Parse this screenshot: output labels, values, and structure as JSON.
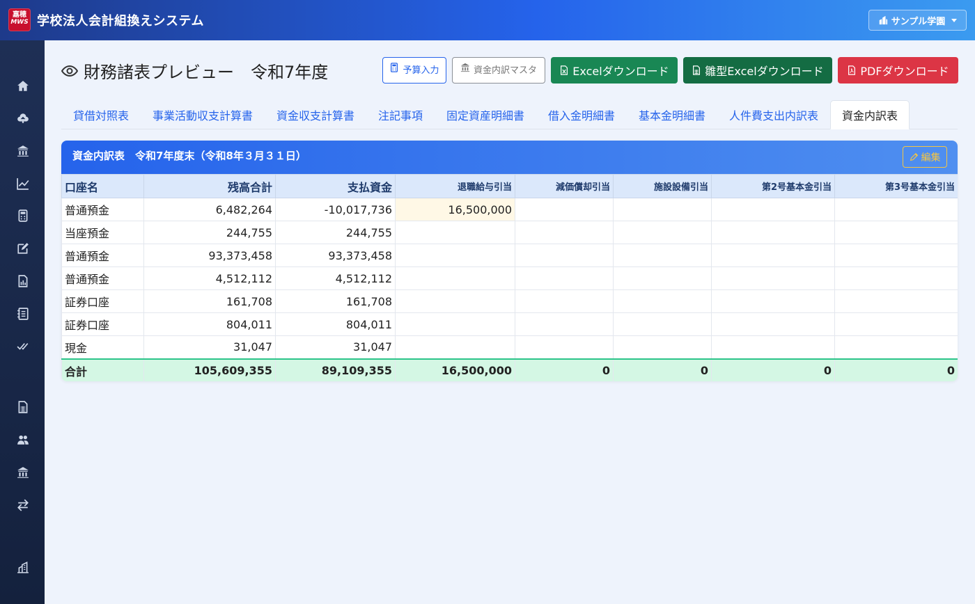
{
  "app": {
    "logo_top": "嘉穂",
    "logo_bottom": "MWS",
    "title": "学校法人会計組換えシステム",
    "school_selector": "サンプル学園"
  },
  "sidebar": {
    "icons": [
      "home-icon",
      "cloud-upload-icon",
      "bank-icon",
      "chart-line-icon",
      "calculator-icon",
      "edit-icon",
      "report-icon",
      "journal-icon",
      "check-all-icon",
      "spreadsheet-icon",
      "users-icon",
      "bank-icon",
      "transfer-icon",
      "building-icon"
    ]
  },
  "header": {
    "page_title": "財務諸表プレビュー　令和7年度",
    "buttons": {
      "budget_input": "予算入力",
      "fund_master": "資金内訳マスタ",
      "excel_download": "Excelダウンロード",
      "template_excel_download": "雛型Excelダウンロード",
      "pdf_download": "PDFダウンロード"
    }
  },
  "tabs": [
    "貸借対照表",
    "事業活動収支計算書",
    "資金収支計算書",
    "注記事項",
    "固定資産明細書",
    "借入金明細書",
    "基本金明細書",
    "人件費支出内訳表",
    "資金内訳表"
  ],
  "active_tab": "資金内訳表",
  "card": {
    "title": "資金内訳表　令和7年度末（令和8年３月３１日）",
    "edit_label": "編集"
  },
  "table": {
    "columns": [
      "口座名",
      "残高合計",
      "支払資金",
      "退職給与引当",
      "減価償却引当",
      "施設設備引当",
      "第2号基本金引当",
      "第3号基本金引当"
    ],
    "rows": [
      [
        "普通預金",
        "6,482,264",
        "-10,017,736",
        "16,500,000",
        "",
        "",
        "",
        ""
      ],
      [
        "当座預金",
        "244,755",
        "244,755",
        "",
        "",
        "",
        "",
        ""
      ],
      [
        "普通預金",
        "93,373,458",
        "93,373,458",
        "",
        "",
        "",
        "",
        ""
      ],
      [
        "普通預金",
        "4,512,112",
        "4,512,112",
        "",
        "",
        "",
        "",
        ""
      ],
      [
        "証券口座",
        "161,708",
        "161,708",
        "",
        "",
        "",
        "",
        ""
      ],
      [
        "証券口座",
        "804,011",
        "804,011",
        "",
        "",
        "",
        "",
        ""
      ],
      [
        "現金",
        "31,047",
        "31,047",
        "",
        "",
        "",
        "",
        ""
      ]
    ],
    "total": [
      "合計",
      "105,609,355",
      "89,109,355",
      "16,500,000",
      "0",
      "0",
      "0",
      "0"
    ]
  },
  "colors": {
    "accent": "#2563eb",
    "sidebar": "#1e2f55",
    "total_row": "#d4f7e4",
    "highlight_cell": "#fff8e6"
  }
}
